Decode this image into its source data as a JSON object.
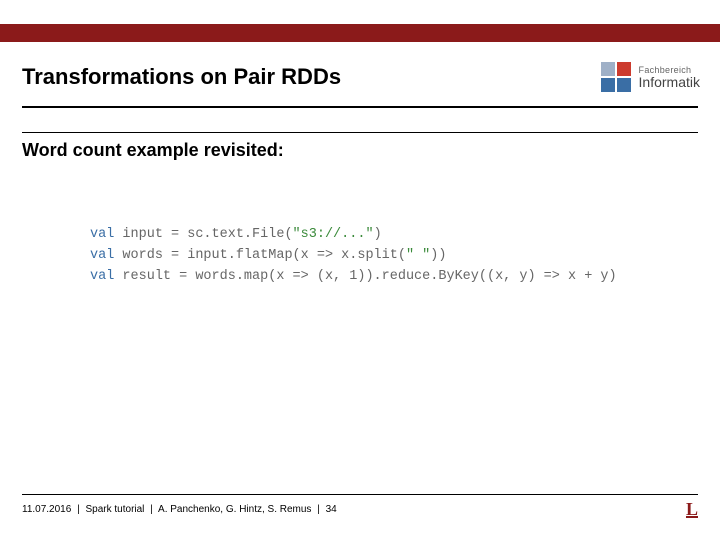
{
  "header": {
    "title": "Transformations on Pair RDDs",
    "logo": {
      "line1": "Fachbereich",
      "line2": "Informatik"
    }
  },
  "subtitle": "Word count example revisited:",
  "code": {
    "l1_kw": "val",
    "l1_rest": " input = sc.text.File(",
    "l1_str": "\"s3://...\"",
    "l1_close": ")",
    "l2_kw": "val",
    "l2_rest": " words = input.flatMap(x => x.split(",
    "l2_str": "\" \"",
    "l2_close": "))",
    "l3_kw": "val",
    "l3_rest": " result = words.map(x => (x, 1)).reduce.ByKey((x, y) => x + y)"
  },
  "footer": {
    "date": "11.07.2016",
    "course": "Spark tutorial",
    "authors": "A. Panchenko, G. Hintz, S. Remus",
    "page": "34",
    "sep": "|",
    "corner": "L"
  }
}
